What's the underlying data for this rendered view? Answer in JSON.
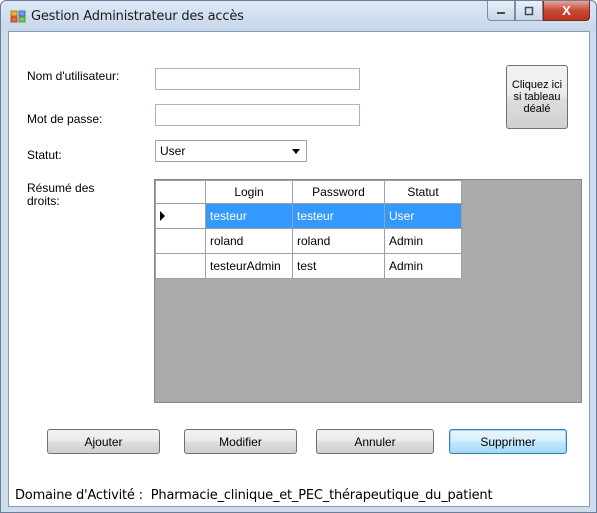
{
  "window": {
    "title": "Gestion Administrateur des accès",
    "close_glyph": "X"
  },
  "form": {
    "username_label": "Nom d'utilisateur:",
    "username_value": "",
    "password_label": "Mot de passe:",
    "password_value": "",
    "status_label": "Statut:",
    "status_value": "User",
    "summary_label": "Résumé des droits:",
    "help_button_label": "Cliquez ici si tableau déalé"
  },
  "grid": {
    "columns": [
      "Login",
      "Password",
      "Statut"
    ],
    "rows": [
      [
        "testeur",
        "testeur",
        "User"
      ],
      [
        "roland",
        "roland",
        "Admin"
      ],
      [
        "testeurAdmin",
        "test",
        "Admin"
      ]
    ],
    "selected_row": 0
  },
  "buttons": {
    "add": "Ajouter",
    "modify": "Modifier",
    "cancel": "Annuler",
    "delete": "Supprimer"
  },
  "footer": {
    "label": "Domaine d'Activité :",
    "value": "Pharmacie_clinique_et_PEC_thérapeutique_du_patient"
  },
  "colors": {
    "selection": "#3399ff",
    "title_bar": "#c7d7ea",
    "close_button": "#c74a36"
  }
}
